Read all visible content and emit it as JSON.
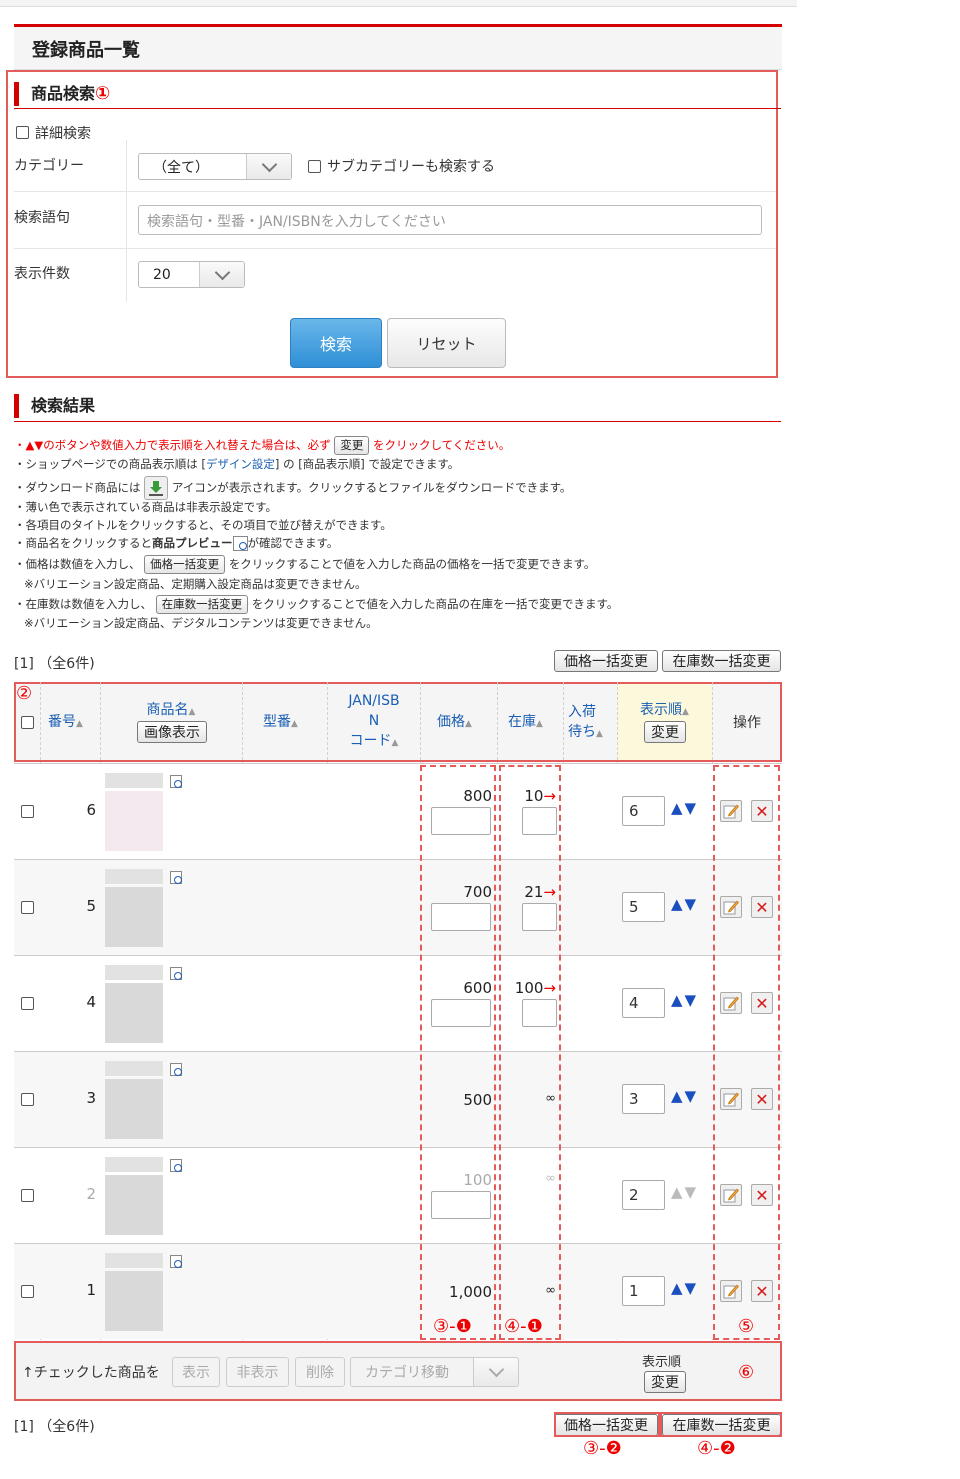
{
  "page": {
    "title": "登録商品一覧"
  },
  "search": {
    "heading": "商品検索",
    "annotation": "①",
    "detail_label": "詳細検索",
    "category_label": "カテゴリー",
    "category_value": "（全て）",
    "subcategory_label": "サブカテゴリーも検索する",
    "keyword_label": "検索語句",
    "keyword_placeholder": "検索語句・型番・JAN/ISBNを入力してください",
    "count_label": "表示件数",
    "count_value": "20",
    "search_button": "検索",
    "reset_button": "リセット"
  },
  "results": {
    "heading": "検索結果",
    "notes": {
      "n1a": "・▲▼のボタンや数値入力で表示順を入れ替えた場合は、必ず",
      "n1btn": "変更",
      "n1b": "をクリックしてください。",
      "n2a": "・ショップページでの商品表示順は [",
      "n2link": "デザイン設定",
      "n2b": "] の [商品表示順] で設定できます。",
      "n3a": "・ダウンロード商品には",
      "n3b": "アイコンが表示されます。クリックするとファイルをダウンロードできます。",
      "n4": "・薄い色で表示されている商品は非表示設定です。",
      "n5": "・各項目のタイトルをクリックすると、その項目で並び替えができます。",
      "n6a": "・商品名をクリックすると",
      "n6bold": "商品プレビュー",
      "n6b": "が確認できます。",
      "n7a": "・価格は数値を入力し、",
      "n7btn": "価格一括変更",
      "n7b": "をクリックすることで値を入力した商品の価格を一括で変更できます。",
      "n8": "※バリエーション設定商品、定期購入設定商品は変更できません。",
      "n9a": "・在庫数は数値を入力し、",
      "n9btn": "在庫数一括変更",
      "n9b": "をクリックすることで値を入力した商品の在庫を一括で変更できます。",
      "n10": "※バリエーション設定商品、デジタルコンテンツは変更できません。"
    },
    "pager": "[1] （全6件)",
    "bulk_price_button": "価格一括変更",
    "bulk_stock_button": "在庫数一括変更"
  },
  "table": {
    "annotation": "②",
    "headers": {
      "number": "番号",
      "name": "商品名",
      "image_button": "画像表示",
      "model": "型番",
      "jan_1": "JAN/ISB",
      "jan_2": "N",
      "jan_3": "コード",
      "price": "価格",
      "stock": "在庫",
      "arrival_1": "入荷",
      "arrival_2": "待ち",
      "order": "表示順",
      "order_button": "変更",
      "ops": "操作"
    },
    "rows": [
      {
        "number": "6",
        "price": "800",
        "stock": "10",
        "stock_arrow": "→",
        "order": "6",
        "hidden": false
      },
      {
        "number": "5",
        "price": "700",
        "stock": "21",
        "stock_arrow": "→",
        "order": "5",
        "hidden": false
      },
      {
        "number": "4",
        "price": "600",
        "stock": "100",
        "stock_arrow": "→",
        "order": "4",
        "hidden": false
      },
      {
        "number": "3",
        "price": "500",
        "stock": "∞",
        "stock_arrow": "",
        "order": "3",
        "hidden": false
      },
      {
        "number": "2",
        "price": "100",
        "stock": "∞",
        "stock_arrow": "",
        "order": "2",
        "hidden": true
      },
      {
        "number": "1",
        "price": "1,000",
        "stock": "∞",
        "stock_arrow": "",
        "order": "1",
        "hidden": false
      }
    ],
    "anno_price": "③-❶",
    "anno_stock": "④-❶",
    "anno_ops": "⑤",
    "footer": {
      "checked_label": "↑チェックした商品を",
      "show": "表示",
      "hide": "非表示",
      "delete": "削除",
      "category_move": "カテゴリ移動",
      "order_label": "表示順",
      "order_button": "変更",
      "annotation": "⑥"
    }
  },
  "bottom": {
    "pager": "[1] （全6件)",
    "bulk_price_button": "価格一括変更",
    "bulk_stock_button": "在庫数一括変更",
    "anno_price": "③-❷",
    "anno_stock": "④-❷"
  },
  "colors": {
    "accent_red": "#d50000",
    "annotation_red": "#e35b5b",
    "link_blue": "#1a5fb4",
    "order_header_bg": "#fbf8dc"
  }
}
